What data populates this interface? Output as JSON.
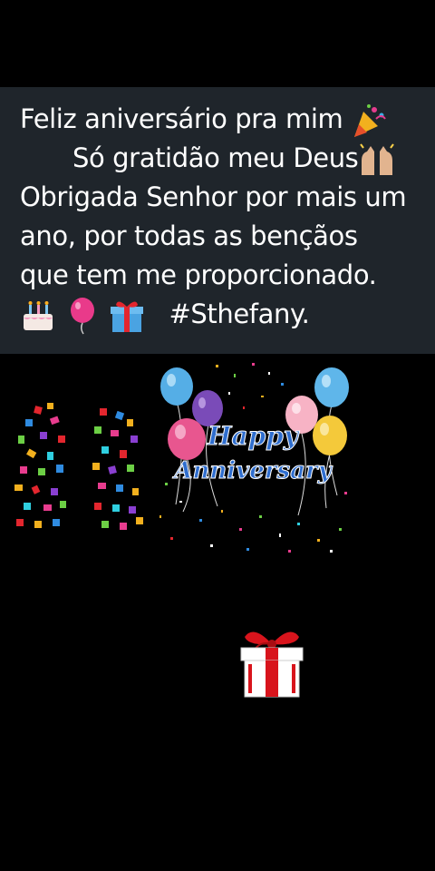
{
  "caption": {
    "line1_text": "Feliz aniversário pra mim",
    "line1_emoji": "party-popper-icon",
    "line2_text": "Só gratidão meu Deus",
    "line2_emoji": "raising-hands-icon",
    "line3": "Obrigada Senhor por mais um",
    "line4": "ano, por todas as bençãos",
    "line5": "que tem me proporcionado.",
    "line6_emojis": [
      "birthday-cake-icon",
      "balloon-icon",
      "wrapped-gift-icon"
    ],
    "hashtag": "#Sthefany.",
    "background_color": "#1f252b",
    "text_color": "#ffffff"
  },
  "sticker": {
    "happy_text": "Happy",
    "anniversary_text": "Anniversary"
  },
  "colors": {
    "background": "#000000",
    "gift_red": "#d8141c",
    "anniversary_blue": "#2f6ecf"
  }
}
